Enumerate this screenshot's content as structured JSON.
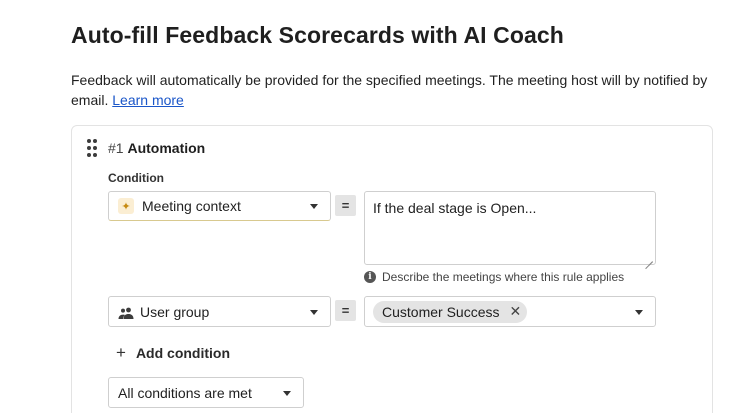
{
  "page": {
    "title": "Auto-fill Feedback Scorecards with AI Coach",
    "description": "Feedback will automatically be provided for the specified meetings. The meeting host will by notified by email.",
    "learn_more": "Learn more"
  },
  "automation": {
    "number": "#1",
    "name": "Automation",
    "condition_label": "Condition",
    "conditions": [
      {
        "field": "Meeting context",
        "field_icon": "sparkle-icon",
        "operator": "=",
        "value": "If the deal stage is Open...",
        "hint": "Describe the meetings where this rule applies"
      },
      {
        "field": "User group",
        "field_icon": "people-icon",
        "operator": "=",
        "chip": "Customer Success"
      }
    ],
    "add_condition": "Add condition",
    "match_mode": "All conditions are met"
  }
}
